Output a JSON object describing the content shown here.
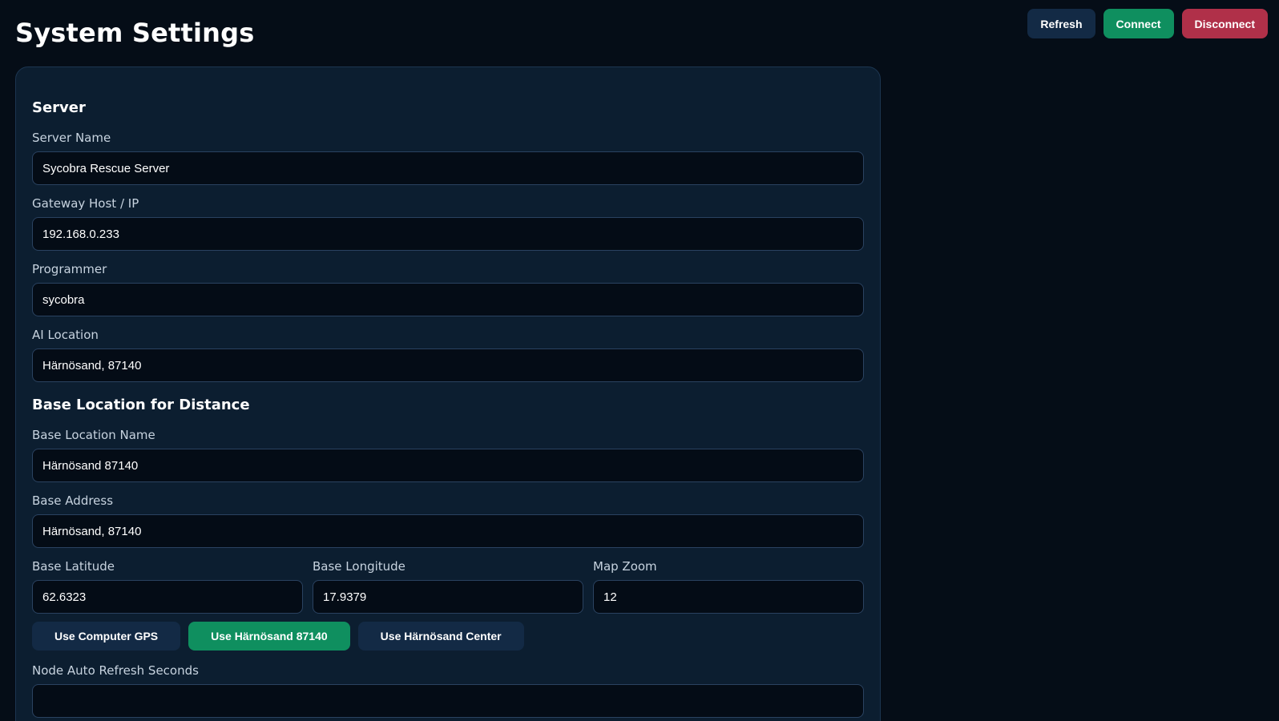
{
  "header": {
    "title": "System Settings",
    "refresh_label": "Refresh",
    "connect_label": "Connect",
    "disconnect_label": "Disconnect"
  },
  "server": {
    "heading": "Server",
    "server_name": {
      "label": "Server Name",
      "value": "Sycobra Rescue Server"
    },
    "gateway": {
      "label": "Gateway Host / IP",
      "value": "192.168.0.233"
    },
    "programmer": {
      "label": "Programmer",
      "value": "sycobra"
    },
    "ai_location": {
      "label": "AI Location",
      "value": "Härnösand, 87140"
    }
  },
  "base": {
    "heading": "Base Location for Distance",
    "name": {
      "label": "Base Location Name",
      "value": "Härnösand 87140"
    },
    "address": {
      "label": "Base Address",
      "value": "Härnösand, 87140"
    },
    "latitude": {
      "label": "Base Latitude",
      "value": "62.6323"
    },
    "longitude": {
      "label": "Base Longitude",
      "value": "17.9379"
    },
    "zoom": {
      "label": "Map Zoom",
      "value": "12"
    },
    "use_gps_label": "Use Computer GPS",
    "use_postcode_label": "Use Härnösand 87140",
    "use_center_label": "Use Härnösand Center"
  },
  "refresh": {
    "label": "Node Auto Refresh Seconds",
    "value": ""
  },
  "colors": {
    "background": "#050d17",
    "card": "#0c1e30",
    "button_dark": "#132a45",
    "button_green": "#0f8f5f",
    "button_red": "#b03049"
  }
}
